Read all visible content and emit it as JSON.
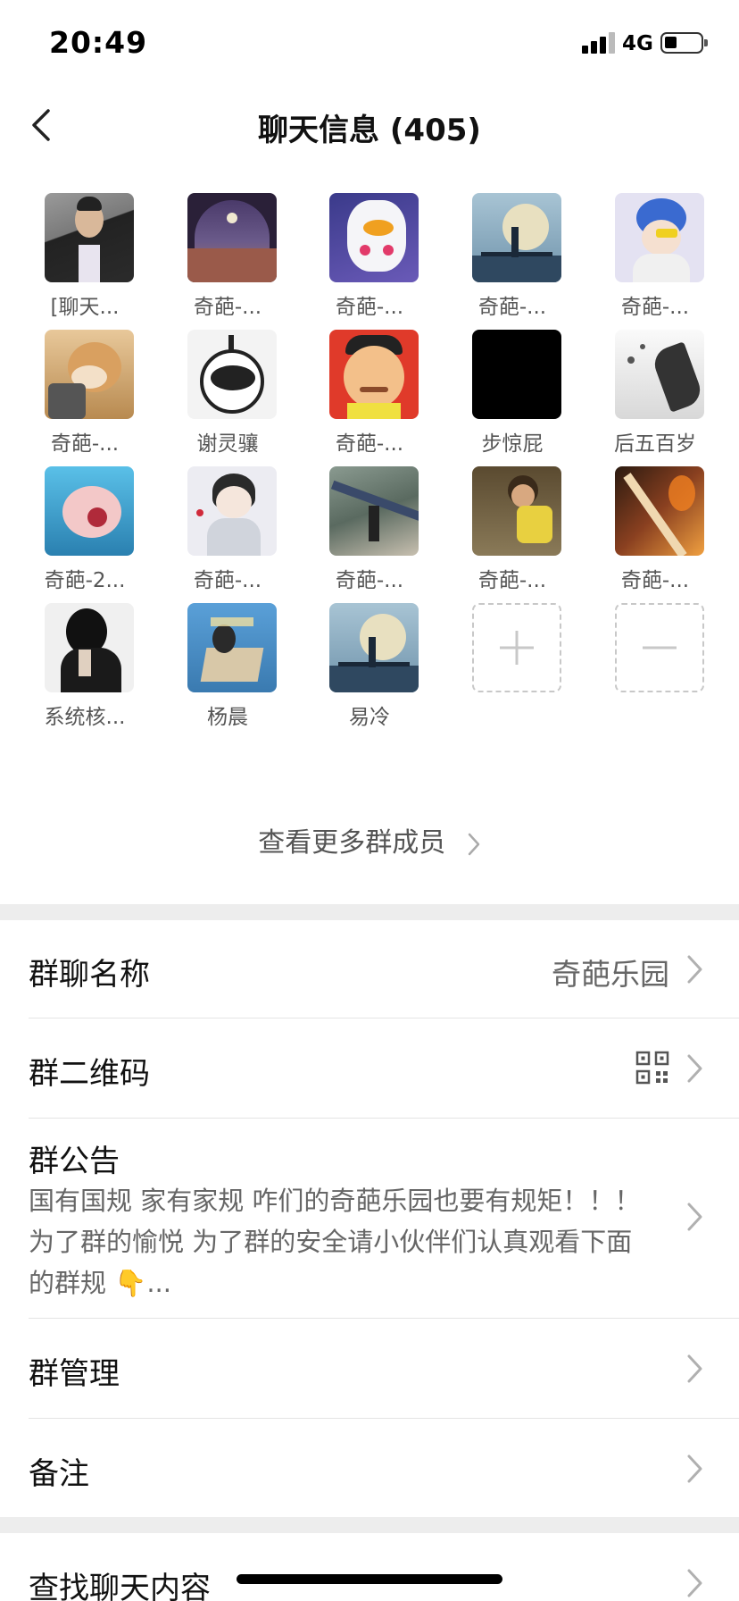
{
  "status_bar": {
    "time": "20:49",
    "network": "4G",
    "signal_bars": 4,
    "battery_level": 0.3
  },
  "nav": {
    "title": "聊天信息 (405)",
    "back_icon": "chevron-left-icon"
  },
  "members": [
    {
      "name": "[聊天...",
      "colors": [
        "#8a8a8a",
        "#2b2b2b"
      ]
    },
    {
      "name": "奇葩-...",
      "colors": [
        "#3a2c4a",
        "#9a6a5a"
      ]
    },
    {
      "name": "奇葩-...",
      "colors": [
        "#e9e6f3",
        "#5a4ea8"
      ]
    },
    {
      "name": "奇葩-...",
      "colors": [
        "#98b7c8",
        "#314a64"
      ]
    },
    {
      "name": "奇葩-...",
      "colors": [
        "#d8d8ee",
        "#3a6ad0"
      ]
    },
    {
      "name": "奇葩-...",
      "colors": [
        "#d9a96a",
        "#6e5230"
      ]
    },
    {
      "name": "谢灵骧",
      "colors": [
        "#f5f5f5",
        "#222222"
      ]
    },
    {
      "name": "奇葩-...",
      "colors": [
        "#e03a2a",
        "#f3c08a"
      ]
    },
    {
      "name": "步惊屁",
      "colors": [
        "#000000",
        "#000000"
      ]
    },
    {
      "name": "后五百岁",
      "colors": [
        "#f0f0f0",
        "#555555"
      ]
    },
    {
      "name": "奇葩-2...",
      "colors": [
        "#4ab0d8",
        "#f0b0b0"
      ]
    },
    {
      "name": "奇葩-...",
      "colors": [
        "#e8e8f0",
        "#444444"
      ]
    },
    {
      "name": "奇葩-...",
      "colors": [
        "#7a8a80",
        "#c8c0b0"
      ]
    },
    {
      "name": "奇葩-...",
      "colors": [
        "#6a5a40",
        "#e8d040"
      ]
    },
    {
      "name": "奇葩-...",
      "colors": [
        "#4a3020",
        "#e08030"
      ]
    },
    {
      "name": "系统核...",
      "colors": [
        "#f0f0f0",
        "#111111"
      ]
    },
    {
      "name": "杨晨",
      "colors": [
        "#4a90c8",
        "#d8c8a8"
      ]
    },
    {
      "name": "易冷",
      "colors": [
        "#98b7c8",
        "#314a64"
      ]
    }
  ],
  "add_member_icon": "plus-icon",
  "remove_member_icon": "minus-icon",
  "more_members_label": "查看更多群成员",
  "settings": {
    "group_name_label": "群聊名称",
    "group_name_value": "奇葩乐园",
    "qr_label": "群二维码",
    "qr_icon": "qr-code-icon",
    "notice_label": "群公告",
    "notice_line1": "国有国规 家有家规 咋们的奇葩乐园也要有规矩！！！",
    "notice_line2": "为了群的愉悦 为了群的安全请小伙伴们认真观看下面",
    "notice_line3": "的群规 👇...",
    "manage_label": "群管理",
    "remark_label": "备注",
    "search_label": "查找聊天内容"
  },
  "colors": {
    "background": "#ffffff",
    "section_gap": "#ededed",
    "secondary_text": "#666666"
  }
}
